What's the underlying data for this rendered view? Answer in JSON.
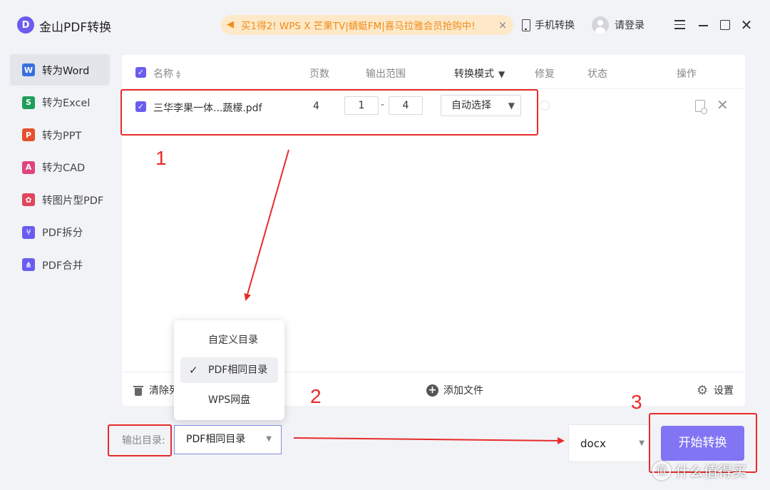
{
  "app": {
    "logo_letter": "D",
    "title": "金山PDF转换"
  },
  "promo": {
    "text": "买1得2! WPS X 芒果TV|蜻蜓FM|喜马拉雅会员抢购中!",
    "close": "×"
  },
  "header": {
    "mobile_convert": "手机转换",
    "login": "请登录"
  },
  "sidebar": {
    "items": [
      {
        "icon_letter": "W",
        "label": "转为Word",
        "color": "#3b6fe0",
        "active": true
      },
      {
        "icon_letter": "S",
        "label": "转为Excel",
        "color": "#1f9e5a"
      },
      {
        "icon_letter": "P",
        "label": "转为PPT",
        "color": "#e5502f"
      },
      {
        "icon_letter": "A",
        "label": "转为CAD",
        "color": "#e0457a"
      },
      {
        "icon_letter": "✿",
        "label": "转图片型PDF",
        "color": "#e0455c"
      },
      {
        "icon_letter": "⑂",
        "label": "PDF拆分",
        "color": "#6b5cf0"
      },
      {
        "icon_letter": "⋔",
        "label": "PDF合并",
        "color": "#6b5cf0"
      }
    ]
  },
  "table": {
    "headers": {
      "name": "名称",
      "pages": "页数",
      "range": "输出范围",
      "mode": "转换模式",
      "repair": "修复",
      "status": "状态",
      "action": "操作"
    },
    "row": {
      "file_name": "三华李果一体...蔬檬.pdf",
      "pages": "4",
      "range_from": "1",
      "range_sep": "-",
      "range_to": "4",
      "mode": "自动选择"
    }
  },
  "bottom_bar": {
    "clear": "清除列表",
    "add_file": "添加文件",
    "settings": "设置"
  },
  "dir_menu": {
    "options": [
      {
        "label": "自定义目录"
      },
      {
        "label": "PDF相同目录",
        "selected": true
      },
      {
        "label": "WPS网盘"
      }
    ]
  },
  "output": {
    "label": "输出目录:",
    "selected_dir": "PDF相同目录",
    "format": "docx",
    "start": "开始转换"
  },
  "annotations": {
    "n1": "1",
    "n2": "2",
    "n3": "3"
  },
  "watermark": {
    "logo": "值",
    "text": "什么值得买"
  },
  "colors": {
    "accent": "#6b5cf0",
    "button": "#8175f3",
    "annotation": "#e82a2a",
    "promo_bg": "#fde9c8",
    "promo_text": "#f08c1a"
  }
}
